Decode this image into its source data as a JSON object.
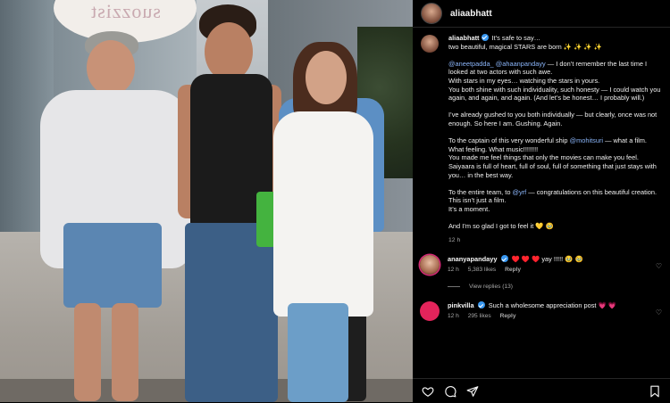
{
  "photo": {
    "sign_text": "suozzist"
  },
  "header": {
    "username": "aliaabhatt"
  },
  "post": {
    "username": "aliaabhatt",
    "lines": [
      {
        "type": "first",
        "text": "It’s safe to say…"
      },
      {
        "type": "text",
        "text": "two beautiful, magical STARS are born ✨ ✨ ✨ ✨"
      },
      {
        "type": "gap"
      },
      {
        "type": "mention_line",
        "m1": "@aneetpadda_",
        "m2": "@ahaanpandayy",
        "rest": "— I don’t remember the last time I looked at two actors with such awe."
      },
      {
        "type": "text",
        "text": "With stars in my eyes… watching the stars in yours."
      },
      {
        "type": "text",
        "text": "You both shine with such individuality, such honesty — I could watch you again, and again, and again. (And let’s be honest… I probably will.)"
      },
      {
        "type": "gap"
      },
      {
        "type": "text",
        "text": "I’ve already gushed to you both individually — but clearly, once was not enough. So here I am. Gushing. Again."
      },
      {
        "type": "gap"
      },
      {
        "type": "mention_mid",
        "pre": "To the captain of this very wonderful ship ",
        "m": "@mohitsuri",
        "post": " — what a film. What feeling. What music!!!!!!!!"
      },
      {
        "type": "text",
        "text": "You made me feel things that only the movies can make you feel. Saiyaara is full of heart, full of soul, full of something that just stays with you… in the best way."
      },
      {
        "type": "gap"
      },
      {
        "type": "mention_mid",
        "pre": "To the entire team, to ",
        "m": "@yrf",
        "post": " — congratulations on this beautiful creation."
      },
      {
        "type": "text",
        "text": "This isn’t just a film."
      },
      {
        "type": "text",
        "text": "It’s a moment."
      },
      {
        "type": "gap"
      },
      {
        "type": "text",
        "text": "And I’m so glad I got to feel it 💛 🥹"
      }
    ],
    "time": "12 h"
  },
  "comments": [
    {
      "username": "ananyapandayy",
      "text": "♥️ ♥️ ♥️ yay !!!!! 🥹 🥹",
      "time": "12 h",
      "likes": "5,383 likes",
      "reply": "Reply",
      "view_replies": "View replies (13)",
      "avatar_text": ""
    },
    {
      "username": "pinkvilla",
      "text": "Such a wholesome appreciation post 💗 💗",
      "time": "12 h",
      "likes": "295 likes",
      "reply": "Reply",
      "avatar_text": ""
    }
  ],
  "colors": {
    "link": "#8ab4f8",
    "verified": "#3897f0",
    "background": "#000000",
    "muted": "#a8a8a8"
  },
  "icons": [
    "heart-icon",
    "comment-icon",
    "share-icon",
    "bookmark-icon",
    "verified-badge-icon"
  ]
}
